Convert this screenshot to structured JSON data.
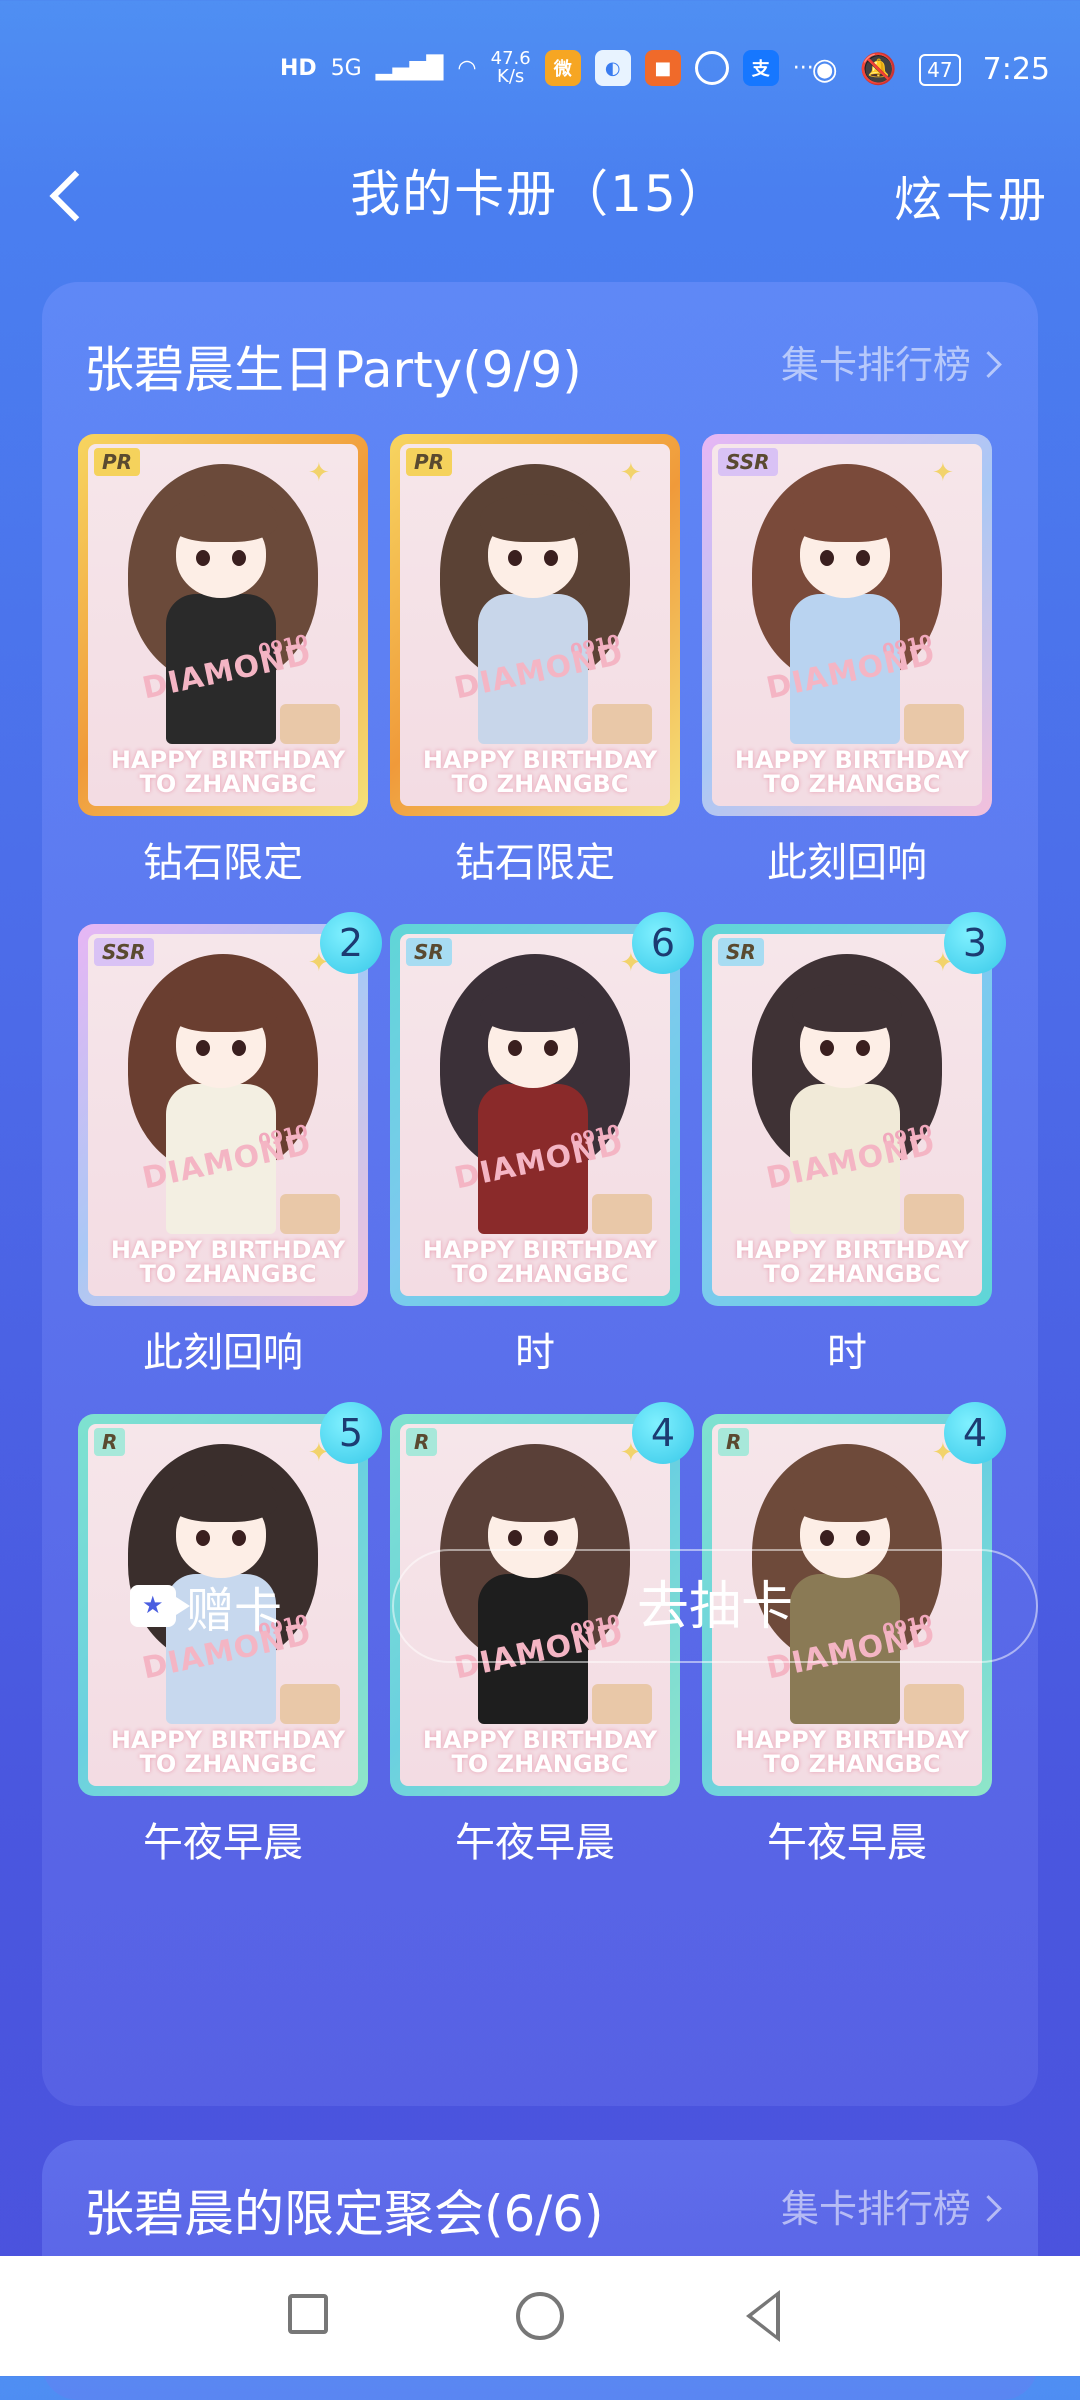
{
  "status_bar": {
    "network": "HD",
    "signal": "5G",
    "speed_value": "47.6",
    "speed_unit": "K/s",
    "battery": "47",
    "time": "7:25",
    "more": "···"
  },
  "header": {
    "title": "我的卡册（15）",
    "album_button": "炫卡册"
  },
  "section1": {
    "title": "张碧晨生日Party(9/9)",
    "ranking": "集卡排行榜",
    "cards": [
      {
        "rarity": "PR",
        "name": "钻石限定",
        "count": "",
        "frame": "gold",
        "hair": "#6b4a3a",
        "outfit": "#2a2a2a"
      },
      {
        "rarity": "PR",
        "name": "钻石限定",
        "count": "",
        "frame": "gold",
        "hair": "#5b4235",
        "outfit": "#c8d6ea"
      },
      {
        "rarity": "SSR",
        "name": "此刻回响",
        "count": "",
        "frame": "holo",
        "hair": "#7a4a3a",
        "outfit": "#b9d3f0"
      },
      {
        "rarity": "SSR",
        "name": "此刻回响",
        "count": "2",
        "frame": "holo",
        "hair": "#6a3e30",
        "outfit": "#f3efe2"
      },
      {
        "rarity": "SR",
        "name": "时",
        "count": "6",
        "frame": "teal",
        "hair": "#3b3038",
        "outfit": "#8a2a2a"
      },
      {
        "rarity": "SR",
        "name": "时",
        "count": "3",
        "frame": "teal",
        "hair": "#3f3235",
        "outfit": "#f1ead8"
      },
      {
        "rarity": "R",
        "name": "午夜早晨",
        "count": "5",
        "frame": "mint",
        "hair": "#3a2e2c",
        "outfit": "#c7d8ee"
      },
      {
        "rarity": "R",
        "name": "午夜早晨",
        "count": "4",
        "frame": "mint",
        "hair": "#5a4038",
        "outfit": "#1e1e1e"
      },
      {
        "rarity": "R",
        "name": "午夜早晨",
        "count": "4",
        "frame": "mint",
        "hair": "#6e4a3a",
        "outfit": "#8a7a55"
      }
    ],
    "card_text": {
      "badge": "0910",
      "diamond": "DIAMOND",
      "hb1": "HAPPY BIRTHDAY",
      "hb2": "TO ZHANGBC"
    }
  },
  "actions": {
    "gift_label": "赠卡",
    "draw_label": "去抽卡"
  },
  "section2": {
    "title": "张碧晨的限定聚会(6/6)",
    "ranking": "集卡排行榜"
  },
  "colors": {
    "frame_gold": "#f2c14a",
    "frame_holo": "#c9a7f0",
    "frame_teal": "#5fd6d6",
    "frame_mint": "#7fe2cf",
    "count_badge": "#49cfea"
  }
}
